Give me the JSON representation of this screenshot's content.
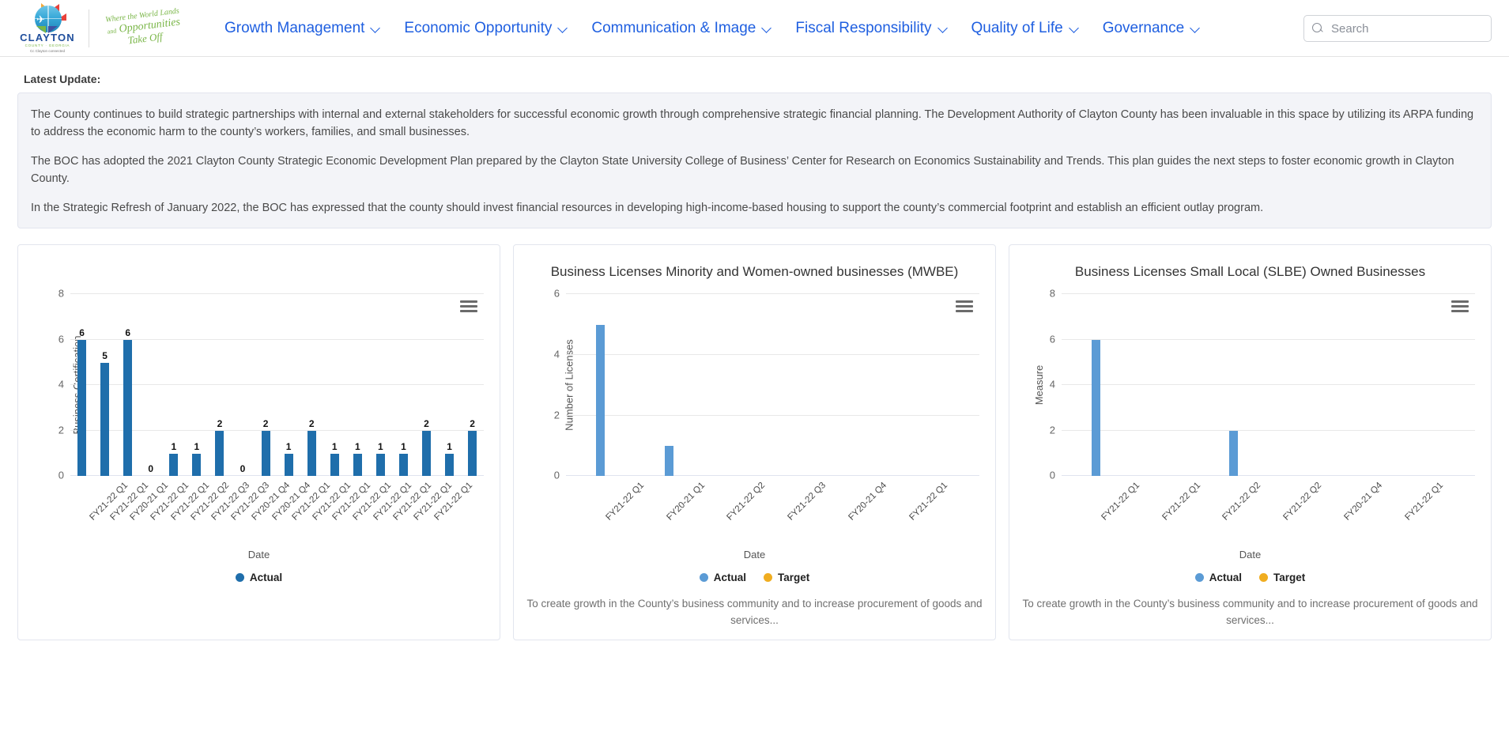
{
  "header": {
    "logo": {
      "word": "CLAYTON",
      "sub": "COUNTY · GEORGIA",
      "tag": "Cc Clayton connected"
    },
    "tagline": {
      "line1": "Where the World Lands",
      "and": "and",
      "line2": "Opportunities",
      "line3": "Take Off"
    },
    "nav": [
      {
        "label": "Growth Management"
      },
      {
        "label": "Economic Opportunity"
      },
      {
        "label": "Communication & Image"
      },
      {
        "label": "Fiscal Responsibility"
      },
      {
        "label": "Quality of Life"
      },
      {
        "label": "Governance"
      }
    ],
    "search": {
      "value": "",
      "placeholder": "Search"
    },
    "link_color": "#1f5fe0"
  },
  "update": {
    "label": "Latest Update:",
    "paragraphs": [
      "The County continues to build strategic partnerships with internal and external stakeholders for successful economic growth through comprehensive strategic financial planning. The Development Authority of Clayton County has been invaluable in this space by utilizing its ARPA funding to address the economic harm to the county’s workers, families, and small businesses.",
      "The BOC has adopted the 2021 Clayton County Strategic Economic Development Plan prepared by the Clayton State University College of Business’ Center for Research on Economics Sustainability and Trends. This plan guides the next steps to foster economic growth in Clayton County.",
      "In the Strategic Refresh of January 2022, the BOC has expressed that the county should invest financial resources in developing high-income-based housing to support the county’s commercial footprint and establish an efficient outlay program."
    ]
  },
  "colors": {
    "bar_dark_blue": "#1f6eab",
    "bar_light_blue": "#5b9bd5",
    "target_orange": "#f0ad20",
    "grid": "#e8e8e8"
  },
  "chart_data": [
    {
      "type": "bar",
      "title": "",
      "xlabel": "Date",
      "ylabel": "Business Certification",
      "ylim": [
        0,
        8
      ],
      "yticks": [
        0,
        2,
        4,
        6,
        8
      ],
      "grid": true,
      "bar_color": "#1f6eab",
      "show_values": true,
      "legend": [
        {
          "name": "Actual",
          "color": "#1f6eab"
        }
      ],
      "legend_position": "bottom",
      "description": "",
      "categories": [
        "FY21-22 Q1",
        "FY21-22 Q1",
        "FY20-21 Q1",
        "FY21-22 Q1",
        "FY21-22 Q1",
        "FY21-22 Q2",
        "FY21-22 Q3",
        "FY21-22 Q3",
        "FY20-21 Q4",
        "FY20-21 Q4",
        "FY21-22 Q1",
        "FY21-22 Q1",
        "FY21-22 Q1",
        "FY21-22 Q1",
        "FY21-22 Q1",
        "FY21-22 Q1",
        "FY21-22 Q1",
        "FY21-22 Q1"
      ],
      "values": [
        6,
        5,
        6,
        0,
        1,
        1,
        2,
        0,
        2,
        1,
        2,
        1,
        1,
        1,
        1,
        2,
        1,
        2
      ]
    },
    {
      "type": "bar",
      "title": "Business Licenses Minority and Women-owned businesses (MWBE)",
      "xlabel": "Date",
      "ylabel": "Number of Licenses",
      "ylim": [
        0,
        6
      ],
      "yticks": [
        0,
        2,
        4,
        6
      ],
      "grid": true,
      "bar_color": "#5b9bd5",
      "show_values": false,
      "legend": [
        {
          "name": "Actual",
          "color": "#5b9bd5"
        },
        {
          "name": "Target",
          "color": "#f0ad20"
        }
      ],
      "legend_position": "bottom",
      "description": "To create growth in the County’s business community and to increase procurement of goods and services...",
      "categories": [
        "FY21-22 Q1",
        "FY20-21 Q1",
        "FY21-22 Q2",
        "FY21-22 Q3",
        "FY20-21 Q4",
        "FY21-22 Q1"
      ],
      "values": [
        5,
        1,
        0,
        0,
        0,
        0
      ]
    },
    {
      "type": "bar",
      "title": "Business Licenses Small Local (SLBE) Owned Businesses",
      "xlabel": "Date",
      "ylabel": "Measure",
      "ylim": [
        0,
        8
      ],
      "yticks": [
        0,
        2,
        4,
        6,
        8
      ],
      "grid": true,
      "bar_color": "#5b9bd5",
      "show_values": false,
      "legend": [
        {
          "name": "Actual",
          "color": "#5b9bd5"
        },
        {
          "name": "Target",
          "color": "#f0ad20"
        }
      ],
      "legend_position": "bottom",
      "description": "To create growth in the County’s business community and to increase procurement of goods and services...",
      "categories": [
        "FY21-22 Q1",
        "FY21-22 Q1",
        "FY21-22 Q2",
        "FY21-22 Q2",
        "FY20-21 Q4",
        "FY21-22 Q1"
      ],
      "values": [
        6,
        0,
        2,
        0,
        0,
        0
      ]
    }
  ],
  "menu_icon": "hamburger-menu-icon"
}
